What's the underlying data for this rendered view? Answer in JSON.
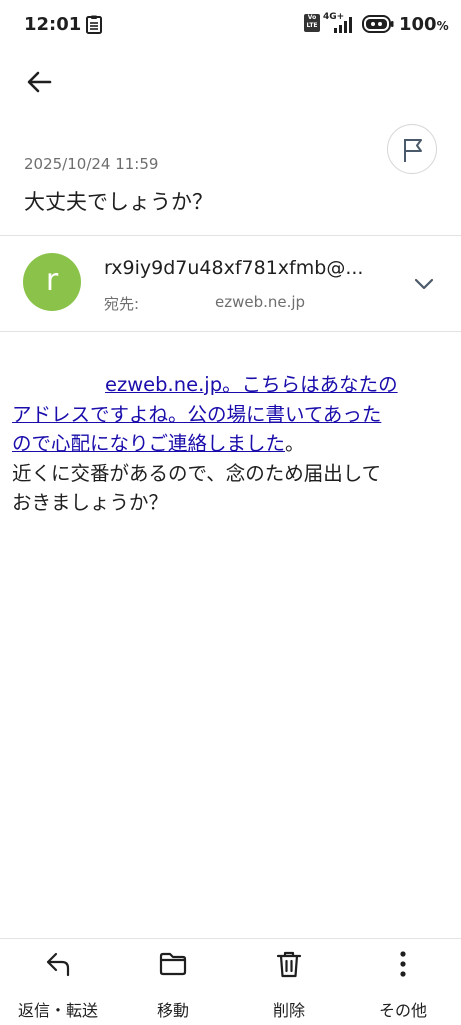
{
  "status_bar": {
    "time": "12:01",
    "network": "4G+",
    "volte": "Vo LTE",
    "battery": "100",
    "battery_unit": "%"
  },
  "header": {
    "back_icon": "arrow-left-icon",
    "flag_icon": "flag-icon"
  },
  "mail": {
    "date": "2025/10/24 11:59",
    "subject": "大丈夫でしょうか？",
    "sender_initial": "r",
    "sender": "rx9iy9d7u48xf781xfmb@...",
    "to_label": "宛先:",
    "to_address_visible": "ezweb.ne.jp",
    "avatar_color": "#8bc34a"
  },
  "body": {
    "line1_link": "ezweb.ne.jp。こちらはあなたの",
    "line2_link": "アドレスですよね。公の場に書いてあった",
    "line3_link": "ので心配になりご連絡しました",
    "line3_tail": "。",
    "line4": "近くに交番があるので、念のため届出して",
    "line5": "おきましょうか？",
    "link_color": "#1a0dab"
  },
  "actions": [
    {
      "label": "返信・転送",
      "icon": "reply-icon"
    },
    {
      "label": "移動",
      "icon": "folder-icon"
    },
    {
      "label": "削除",
      "icon": "trash-icon"
    },
    {
      "label": "その他",
      "icon": "more-vertical-icon"
    }
  ]
}
